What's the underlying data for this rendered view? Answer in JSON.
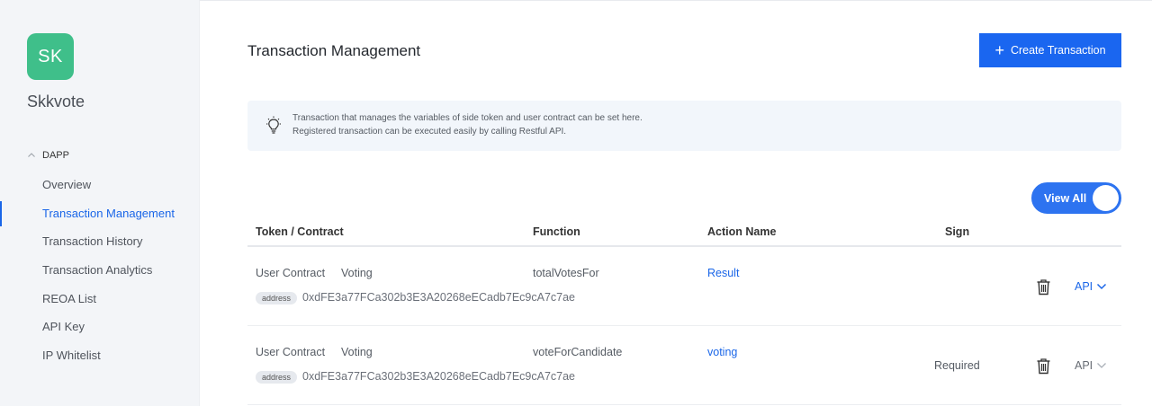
{
  "sidebar": {
    "avatar_initials": "SK",
    "project_name": "Skkvote",
    "section_label": "DAPP",
    "items": [
      {
        "label": "Overview"
      },
      {
        "label": "Transaction Management"
      },
      {
        "label": "Transaction History"
      },
      {
        "label": "Transaction Analytics"
      },
      {
        "label": "REOA List"
      },
      {
        "label": "API Key"
      },
      {
        "label": "IP Whitelist"
      }
    ],
    "active_item": "Transaction Management"
  },
  "header": {
    "title": "Transaction Management",
    "create_button": "Create Transaction"
  },
  "info": {
    "line1": "Transaction that manages the variables of side token and user contract can be set here.",
    "line2": "Registered transaction can be executed easily by calling Restful API."
  },
  "toggle": {
    "label": "View All",
    "on": true
  },
  "table": {
    "headers": {
      "token": "Token / Contract",
      "function": "Function",
      "action": "Action Name",
      "sign": "Sign"
    },
    "rows": [
      {
        "type": "User Contract",
        "name": "Voting",
        "badge": "address",
        "address": "0xdFE3a77FCa302b3E3A20268eECadb7Ec9cA7c7ae",
        "function": "totalVotesFor",
        "action": "Result",
        "sign": "",
        "api": "API"
      },
      {
        "type": "User Contract",
        "name": "Voting",
        "badge": "address",
        "address": "0xdFE3a77FCa302b3E3A20268eECadb7Ec9cA7c7ae",
        "function": "voteForCandidate",
        "action": "voting",
        "sign": "Required",
        "api": "API"
      }
    ]
  },
  "colors": {
    "accent": "#1a66f0",
    "avatar": "#3fbf8a",
    "sidebar_bg": "#f3f5f8",
    "info_bg": "#f2f6fb"
  },
  "icons": [
    "chevron-up-icon",
    "plus-icon",
    "lightbulb-icon",
    "trash-icon",
    "chevron-down-icon"
  ]
}
